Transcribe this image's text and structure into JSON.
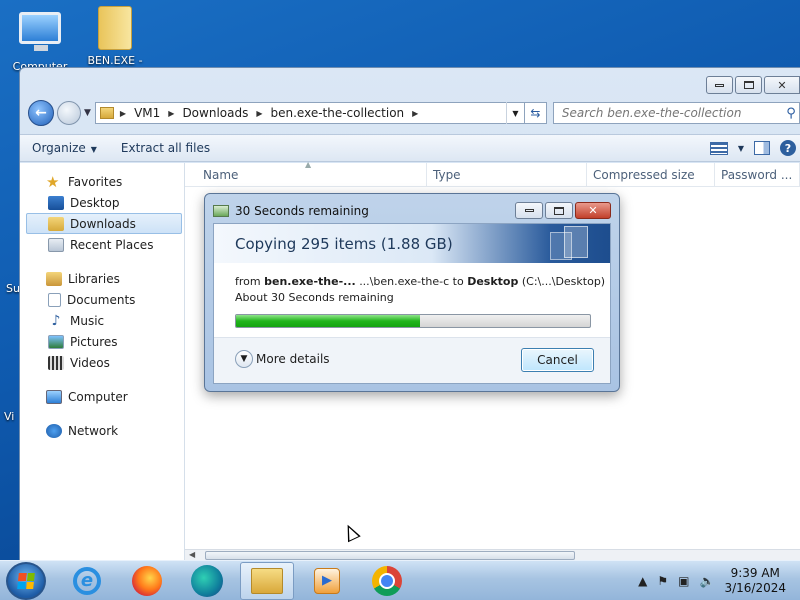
{
  "desktop": {
    "icons": [
      {
        "label": "Computer",
        "icon": "computer-icon"
      },
      {
        "label": "BEN.EXE - The...",
        "icon": "folder-icon"
      }
    ],
    "edge_labels": [
      "Su",
      "Vi"
    ]
  },
  "explorer": {
    "breadcrumb": [
      "VM1",
      "Downloads",
      "ben.exe-the-collection"
    ],
    "search_placeholder": "Search ben.exe-the-collection",
    "commands": {
      "organize": "Organize",
      "extract": "Extract all files"
    },
    "nav": {
      "favorites_header": "Favorites",
      "favorites": [
        "Desktop",
        "Downloads",
        "Recent Places"
      ],
      "libraries_header": "Libraries",
      "libraries": [
        "Documents",
        "Music",
        "Pictures",
        "Videos"
      ],
      "computer": "Computer",
      "network": "Network",
      "selected": "Downloads"
    },
    "columns": [
      "Name",
      "Type",
      "Compressed size",
      "Password ..."
    ]
  },
  "dialog": {
    "title": "30 Seconds remaining",
    "heading": "Copying 295 items (1.88 GB)",
    "from_word": "from",
    "source_bold": "ben.exe-the-...",
    "source_path": "...\\ben.exe-the-c",
    "to_word": "to",
    "dest_bold": "Desktop",
    "dest_path": "(C:\\...\\Desktop)",
    "remaining": "About 30 Seconds remaining",
    "progress_fraction": 0.52,
    "more_details": "More details",
    "cancel": "Cancel"
  },
  "taskbar": {
    "apps": [
      "internet-explorer-icon",
      "firefox-icon",
      "edge-icon",
      "file-explorer-icon",
      "media-player-icon",
      "chrome-icon"
    ],
    "time": "9:39 AM",
    "date": "3/16/2024"
  },
  "colors": {
    "progress_fill": "#22b51c",
    "desktop_bg": "#0f5bb0",
    "close_button": "#c2402b"
  }
}
